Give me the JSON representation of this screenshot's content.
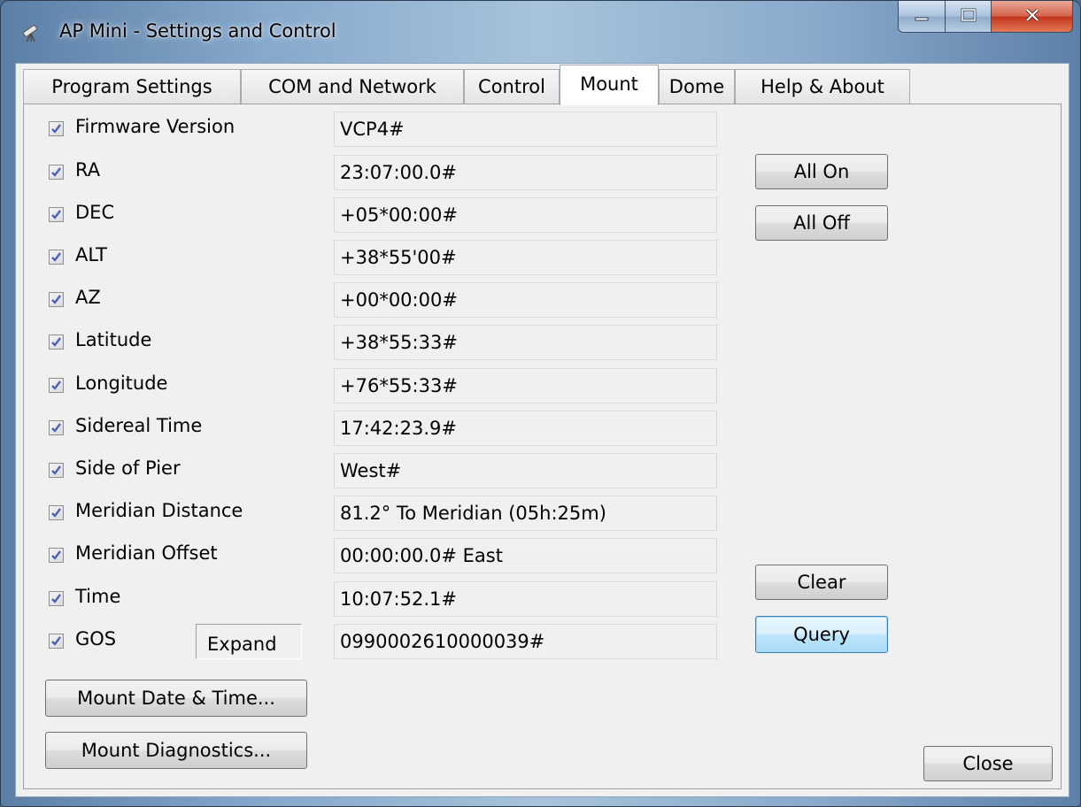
{
  "window": {
    "title": "AP Mini - Settings and Control",
    "icon": "telescope-icon"
  },
  "caption_buttons": {
    "minimize_icon": "minimize-icon",
    "maximize_icon": "maximize-icon",
    "close_icon": "close-icon"
  },
  "tabs": [
    {
      "label": "Program Settings",
      "active": false
    },
    {
      "label": "COM and Network",
      "active": false
    },
    {
      "label": "Control",
      "active": false
    },
    {
      "label": "Mount",
      "active": true
    },
    {
      "label": "Dome",
      "active": false
    },
    {
      "label": "Help & About",
      "active": false
    }
  ],
  "rows": [
    {
      "label": "Firmware Version",
      "checked": true,
      "value": "VCP4#"
    },
    {
      "label": "RA",
      "checked": true,
      "value": "23:07:00.0#"
    },
    {
      "label": "DEC",
      "checked": true,
      "value": "+05*00:00#"
    },
    {
      "label": "ALT",
      "checked": true,
      "value": "+38*55'00#"
    },
    {
      "label": "AZ",
      "checked": true,
      "value": "+00*00:00#"
    },
    {
      "label": "Latitude",
      "checked": true,
      "value": "+38*55:33#"
    },
    {
      "label": "Longitude",
      "checked": true,
      "value": "+76*55:33#"
    },
    {
      "label": "Sidereal Time",
      "checked": true,
      "value": "17:42:23.9#"
    },
    {
      "label": "Side of Pier",
      "checked": true,
      "value": "West#"
    },
    {
      "label": "Meridian Distance",
      "checked": true,
      "value": "81.2° To Meridian (05h:25m)"
    },
    {
      "label": "Meridian Offset",
      "checked": true,
      "value": "00:00:00.0# East"
    },
    {
      "label": "Time",
      "checked": true,
      "value": "10:07:52.1#"
    },
    {
      "label": "GOS",
      "checked": true,
      "value": "0990002610000039#"
    }
  ],
  "gos_expand_label": "Expand",
  "buttons": {
    "all_on": "All On",
    "all_off": "All Off",
    "clear": "Clear",
    "query": "Query",
    "mount_date_time": "Mount Date & Time...",
    "mount_diagnostics": "Mount Diagnostics...",
    "close": "Close"
  },
  "colors": {
    "window_frame": "#86a9cc",
    "client_bg": "#f0f0f0",
    "checkmark": "#4a5fb5",
    "focused_button_border": "#3c7fb1"
  }
}
